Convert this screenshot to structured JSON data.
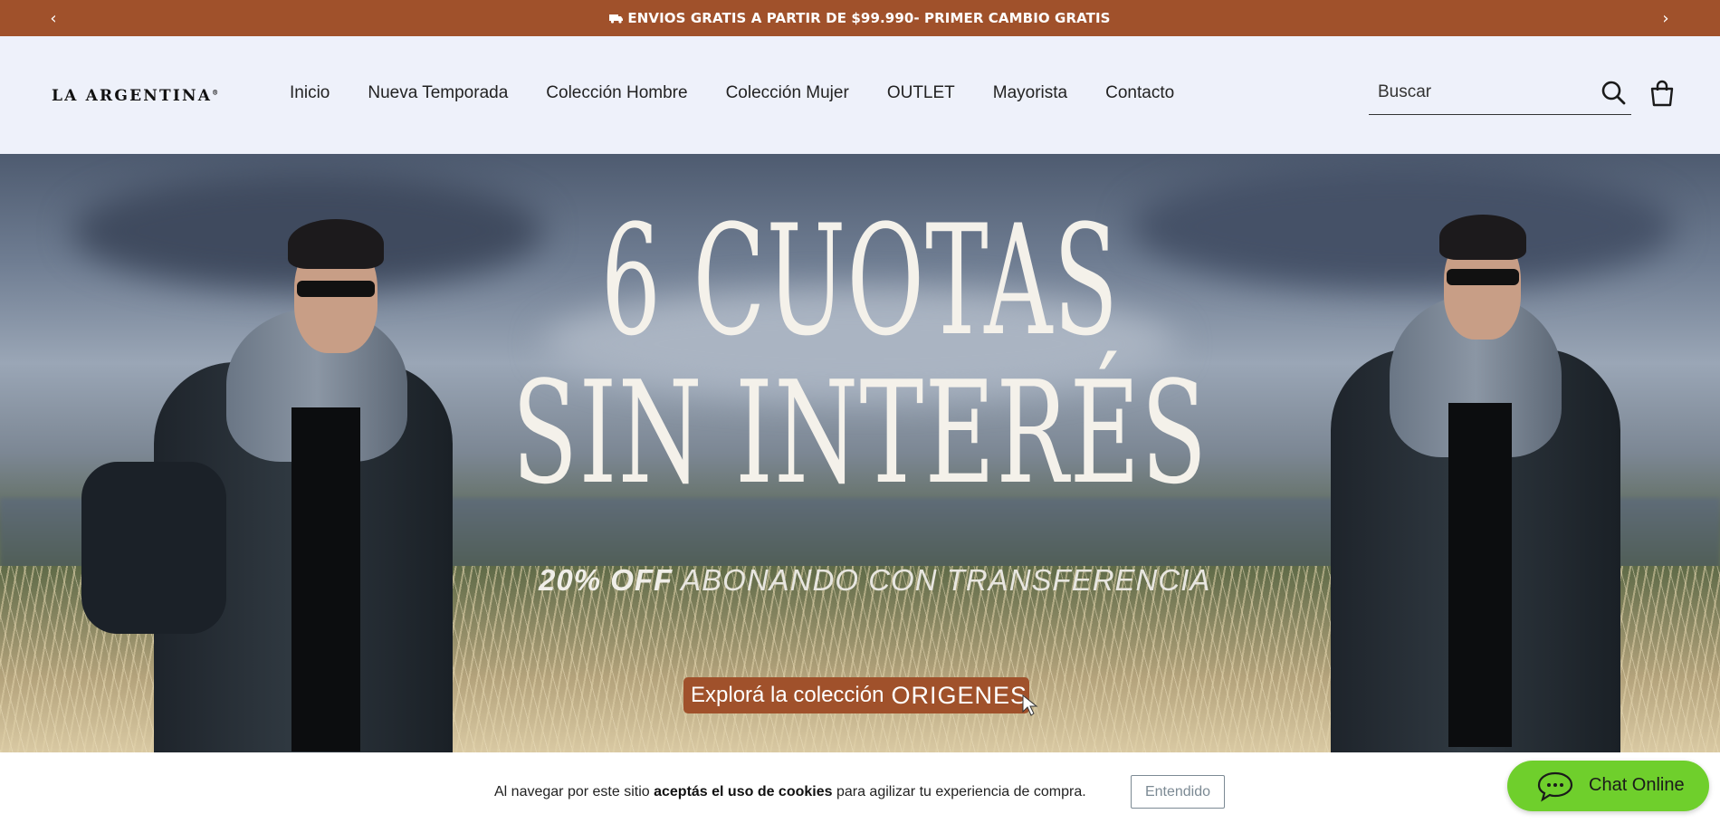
{
  "announcement": {
    "text": "ENVIOS GRATIS A PARTIR DE $99.990- PRIMER CAMBIO GRATIS",
    "prev_arrow": "‹",
    "next_arrow": "›"
  },
  "header": {
    "logo": "LA ARGENTINA",
    "logo_mark": "®",
    "nav": [
      "Inicio",
      "Nueva Temporada",
      "Colección Hombre",
      "Colección Mujer",
      "OUTLET",
      "Mayorista",
      "Contacto"
    ],
    "search_placeholder": "Buscar"
  },
  "hero": {
    "headline_line1": "6 CUOTAS",
    "headline_line2": "SIN INTERÉS",
    "promo_bold": "20% OFF",
    "promo_rest": "ABONANDO CON TRANSFERENCIA",
    "cta_prefix": "Explorá la colección",
    "cta_strong": "ORIGENES"
  },
  "cookie_banner": {
    "text_before": "Al navegar por este sitio ",
    "text_bold": "aceptás el uso de cookies",
    "text_after": " para agilizar tu experiencia de compra.",
    "button": "Entendido"
  },
  "chat": {
    "label": "Chat Online"
  },
  "colors": {
    "brand": "#a0512b",
    "header_bg": "#eef1fa",
    "chat": "#6fcf2c"
  }
}
